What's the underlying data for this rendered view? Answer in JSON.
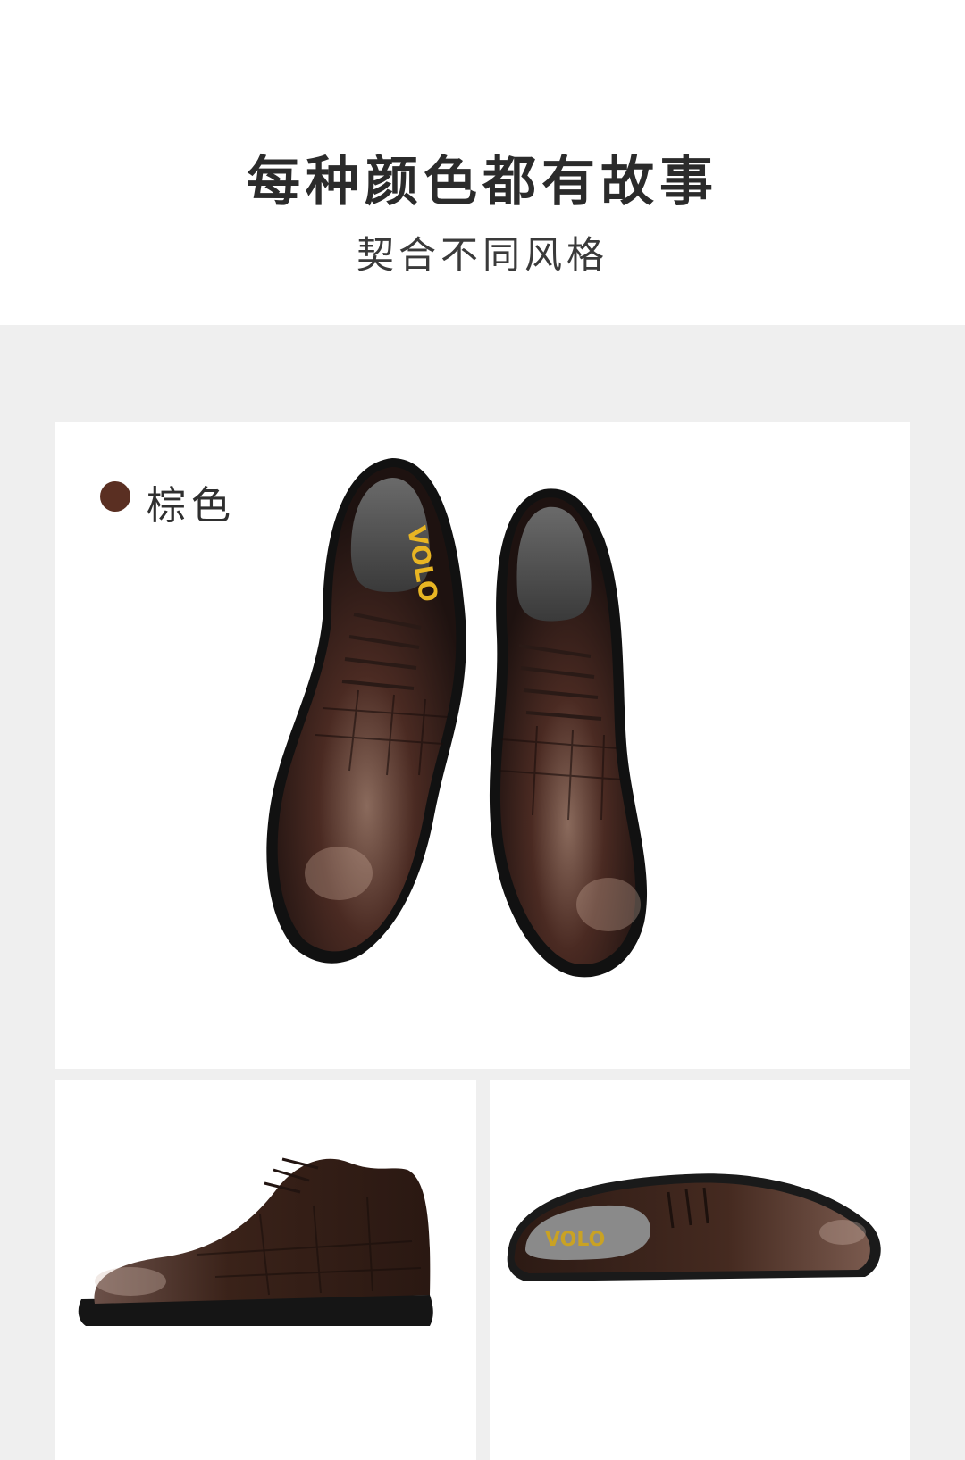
{
  "header": {
    "title": "每种颜色都有故事",
    "subtitle": "契合不同风格"
  },
  "color_option": {
    "label": "棕色",
    "swatch_color": "#5a2f22"
  },
  "brand": {
    "insole_logo": "VOLO"
  },
  "images": {
    "main": "pair-top-view-icon",
    "left": "side-view-icon",
    "right": "lying-side-view-icon"
  }
}
